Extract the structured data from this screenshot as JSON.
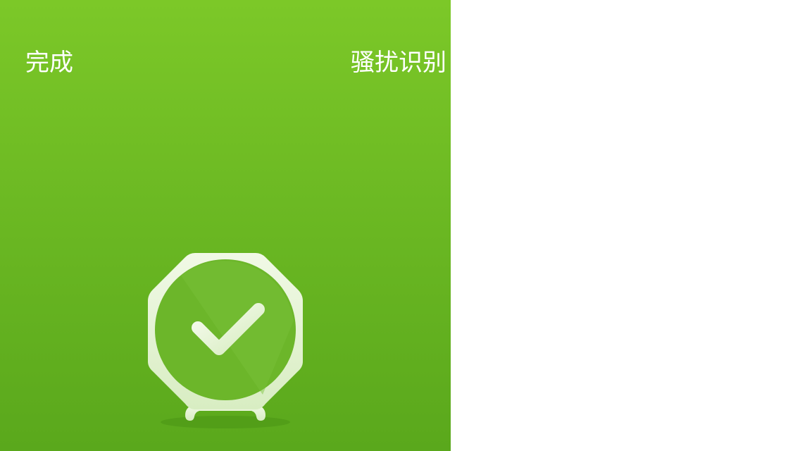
{
  "header": {
    "done_label": "完成",
    "harass_label": "骚扰识别"
  },
  "status": {
    "icon": "shield-check-icon",
    "state": "safe"
  },
  "colors": {
    "panel_top": "#7cc828",
    "panel_bottom": "#5aa81c",
    "icon_fill": "#e9f6d9",
    "text": "#ffffff",
    "background": "#ffffff"
  }
}
